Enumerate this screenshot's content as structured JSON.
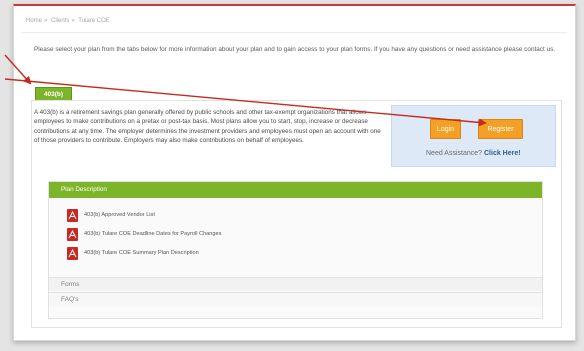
{
  "breadcrumb": [
    "Home",
    "Clients",
    "Tulare COE"
  ],
  "intro": "Please select your plan from the tabs below for more information about your plan and to gain access to your plan forms. If you have any questions or need assistance please contact us.",
  "tab": {
    "label": "403(b)"
  },
  "description": "A 403(b) is a retirement savings plan generally offered by public schools and other tax-exempt organizations that allows employees to make contributions on a pretax or post-tax basis. Most plans allow you to start, stop, increase or decrease contributions at any time. The employer determines the investment providers and employees must open an account with one of those providers to contribute. Employers may also make contributions on behalf of employees.",
  "assist": {
    "login_label": "Login",
    "register_label": "Register",
    "need_text": "Need Assistance?",
    "link_text": "Click Here!"
  },
  "plan_description": {
    "title": "Plan Description",
    "documents": [
      "403(b) Approved Vendor List",
      "403(b) Tulare COE Deadline Dates for Payroll Changes",
      "403(b) Tulare COE Summary Plan Description"
    ]
  },
  "sections": {
    "forms": "Forms",
    "faqs": "FAQ's"
  },
  "colors": {
    "accent_green": "#7db52a",
    "button_orange": "#f4a024",
    "annotation_red": "#c62a1e",
    "assist_bg": "#dde9f6"
  }
}
